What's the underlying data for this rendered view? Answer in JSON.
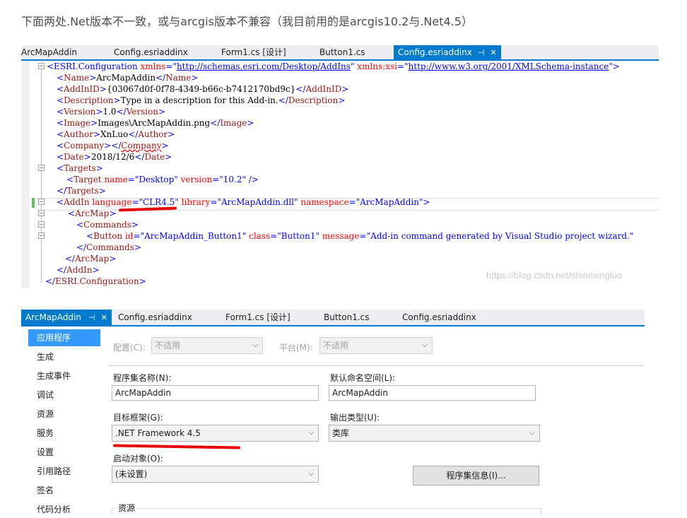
{
  "caption": "下面两处.Net版本不一致，或与arcgis版本不兼容（我目前用的是arcgis10.2与.Net4.5）",
  "editor_tabs": [
    "ArcMapAddin",
    "Config.esriaddinx",
    "Form1.cs [设计]",
    "Button1.cs",
    "Config.esriaddinx"
  ],
  "code": {
    "l1_tag": "<ESRI.Configuration",
    "l1_attr1": " xmlns",
    "l1_val1": "http://schemas.esri.com/Desktop/AddIns",
    "l1_attr2": " xmlns:xsi",
    "l1_val2": "http://www.w3.org/2001/XMLSchema-instance",
    "name_val": "ArcMapAddin",
    "addinid_val": "{03067d0f-0f78-4349-b66c-b7412170bd9c}",
    "description_val": "Type in a description for this Add-in.",
    "version_val": "1.0",
    "image_val": "Images\\ArcMapAddin.png",
    "author_val": "XnLuo",
    "date_val": "2018/12/6",
    "target_name": "Desktop",
    "target_version": "10.2",
    "addin_language": "CLR4.5",
    "addin_library": "ArcMapAddin.dll",
    "addin_namespace": "ArcMapAddin",
    "button_id": "ArcMapAddin_Button1",
    "button_class": "Button1",
    "button_message": "Add-in command generated by Visual Studio project wizard."
  },
  "watermark": "https://blog.csdn.net/shinexingluo",
  "props_tabs": [
    "ArcMapAddin",
    "Config.esriaddinx",
    "Form1.cs [设计]",
    "Button1.cs",
    "Config.esriaddinx"
  ],
  "nav": [
    "应用程序",
    "生成",
    "生成事件",
    "调试",
    "资源",
    "服务",
    "设置",
    "引用路径",
    "签名",
    "代码分析"
  ],
  "config_label": "配置(C):",
  "config_value": "不适用",
  "platform_label": "平台(M):",
  "platform_value": "不适用",
  "assembly_name_label": "程序集名称(N):",
  "assembly_name_value": "ArcMapAddin",
  "default_ns_label": "默认命名空间(L):",
  "default_ns_value": "ArcMapAddin",
  "target_fw_label": "目标框架(G):",
  "target_fw_value": ".NET Framework 4.5",
  "output_type_label": "输出类型(U):",
  "output_type_value": "类库",
  "startup_label": "启动对象(O):",
  "startup_value": "(未设置)",
  "assembly_info_button": "程序集信息(I)...",
  "resources_group": "资源",
  "colors": {
    "accent": "#007acc",
    "nav_selected": "#3399ff",
    "annotation": "#e60000"
  },
  "icons": [
    "pin-icon",
    "close-icon",
    "chevron-down-icon",
    "fold-minus-icon"
  ]
}
